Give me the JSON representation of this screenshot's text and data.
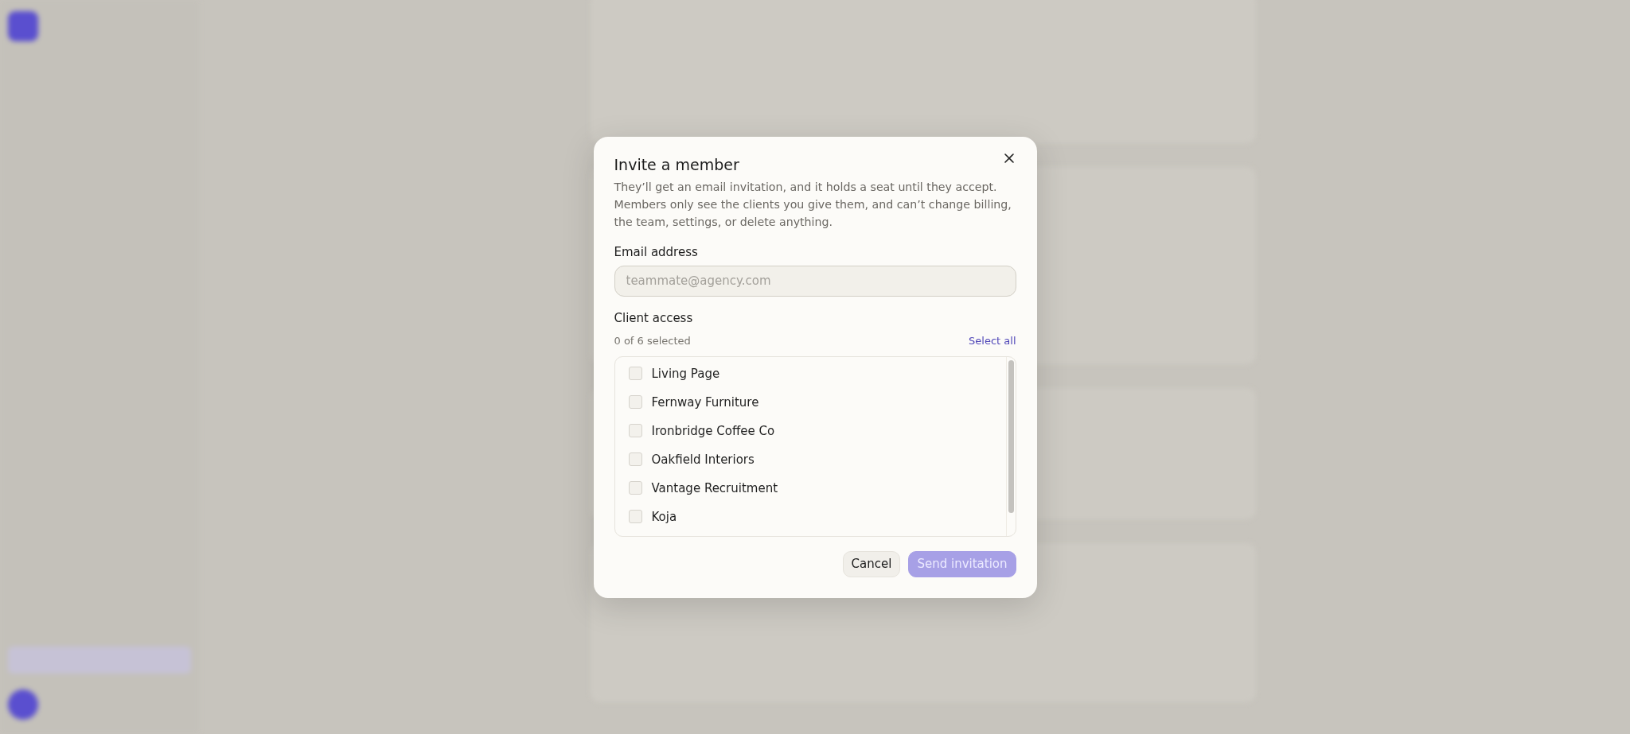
{
  "dialog": {
    "title": "Invite a member",
    "description": "They’ll get an email invitation, and it holds a seat until they accept. Members only see the clients you give them, and can’t change billing, the team, settings, or delete anything.",
    "email": {
      "label": "Email address",
      "placeholder": "teammate@agency.com"
    },
    "client_access": {
      "label": "Client access",
      "count": "0 of 6 selected",
      "select_all": "Select all",
      "clients": [
        {
          "name": "Living Page",
          "checked": false
        },
        {
          "name": "Fernway Furniture",
          "checked": false
        },
        {
          "name": "Ironbridge Coffee Co",
          "checked": false
        },
        {
          "name": "Oakfield Interiors",
          "checked": false
        },
        {
          "name": "Vantage Recruitment",
          "checked": false
        },
        {
          "name": "Koja",
          "checked": false
        }
      ]
    },
    "buttons": [
      {
        "label": "Cancel",
        "kind": "secondary",
        "disabled": false
      },
      {
        "label": "Send invitation",
        "kind": "primary",
        "disabled": true
      }
    ]
  }
}
